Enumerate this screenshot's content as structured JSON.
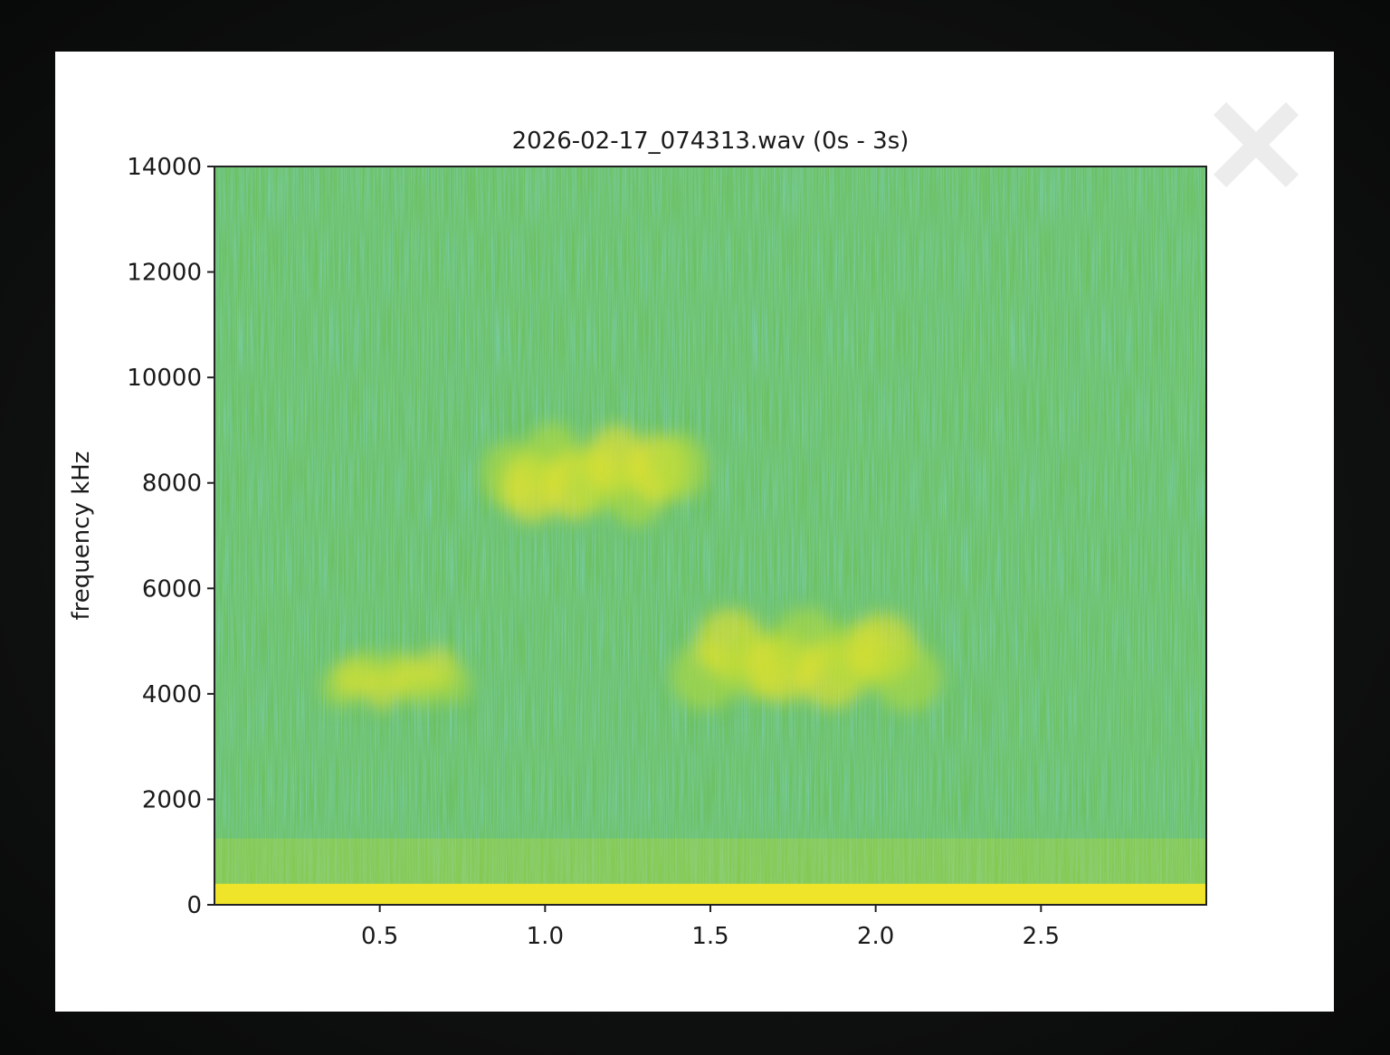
{
  "modal": {
    "close_icon": "close-x-icon"
  },
  "chart_data": {
    "type": "heatmap",
    "title": "2026-02-17_074313.wav (0s - 3s)",
    "xlabel": "",
    "ylabel": "frequency kHz",
    "xlim": [
      0,
      3
    ],
    "ylim": [
      0,
      14000
    ],
    "x_ticks": [
      "0.5",
      "1.0",
      "1.5",
      "2.0",
      "2.5"
    ],
    "x_tick_values": [
      0.5,
      1.0,
      1.5,
      2.0,
      2.5
    ],
    "y_ticks": [
      "0",
      "2000",
      "4000",
      "6000",
      "8000",
      "10000",
      "12000",
      "14000"
    ],
    "y_tick_values": [
      0,
      2000,
      4000,
      6000,
      8000,
      10000,
      12000,
      14000
    ],
    "colormap": [
      "#3aa77a",
      "#6cc163",
      "#b5db39",
      "#efe42a"
    ],
    "background_color": "#6cc163",
    "energy_regions": [
      {
        "t_start": 0.85,
        "t_end": 1.45,
        "f_low": 7000,
        "f_high": 9300,
        "intensity": 0.75
      },
      {
        "t_start": 0.35,
        "t_end": 0.75,
        "f_low": 3600,
        "f_high": 5000,
        "intensity": 0.6
      },
      {
        "t_start": 1.43,
        "t_end": 2.15,
        "f_low": 3500,
        "f_high": 5800,
        "intensity": 0.7
      },
      {
        "t_start": 0.0,
        "t_end": 3.0,
        "f_low": 0,
        "f_high": 400,
        "intensity": 1.0
      }
    ]
  }
}
